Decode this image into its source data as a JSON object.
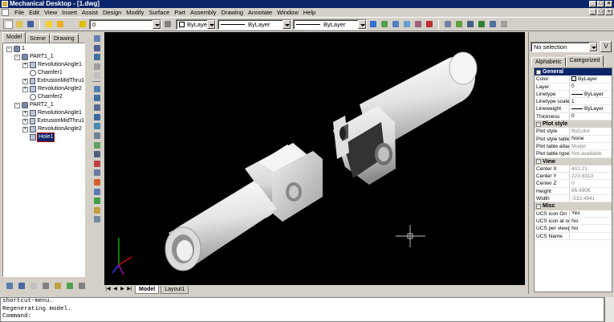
{
  "title": "Mechanical Desktop - [1.dwg]",
  "menu": [
    "File",
    "Edit",
    "View",
    "Insert",
    "Assist",
    "Design",
    "Modify",
    "Surface",
    "Part",
    "Assembly",
    "Drawing",
    "Annotate",
    "Window",
    "Help"
  ],
  "toolbar": {
    "layer_value": "0",
    "color_value": "ByLayer",
    "linetype_value": "ByLayer",
    "lineweight_value": "ByLayer"
  },
  "browser": {
    "tabs": [
      "Model",
      "Scene",
      "Drawing"
    ],
    "active_tab": "Model",
    "tree": [
      {
        "label": "1",
        "level": 0,
        "expander": "⊟",
        "kind": "part"
      },
      {
        "label": "PART1_1",
        "level": 1,
        "expander": "⊟",
        "kind": "part"
      },
      {
        "label": "RevolutionAngle1",
        "level": 2,
        "expander": "⊞",
        "kind": "feature"
      },
      {
        "label": "Chamfer1",
        "level": 2,
        "expander": "",
        "kind": "chamfer"
      },
      {
        "label": "ExtrusionMidThru1",
        "level": 2,
        "expander": "⊞",
        "kind": "feature"
      },
      {
        "label": "RevolutionAngle2",
        "level": 2,
        "expander": "⊞",
        "kind": "feature"
      },
      {
        "label": "Chamfer2",
        "level": 2,
        "expander": "",
        "kind": "chamfer"
      },
      {
        "label": "PART2_1",
        "level": 1,
        "expander": "⊟",
        "kind": "part"
      },
      {
        "label": "RevolutionAngle1",
        "level": 2,
        "expander": "⊞",
        "kind": "feature"
      },
      {
        "label": "ExtrusionMidThru1",
        "level": 2,
        "expander": "⊞",
        "kind": "feature"
      },
      {
        "label": "RevolutionAngle2",
        "level": 2,
        "expander": "⊞",
        "kind": "feature"
      },
      {
        "label": "Hole1",
        "level": 2,
        "expander": "",
        "kind": "hole",
        "selected": true
      }
    ]
  },
  "layout_tabs": [
    "Model",
    "Layout1"
  ],
  "active_layout": "Model",
  "properties": {
    "selection": "No selection",
    "pick_label": "V",
    "tabs": [
      "Alphabetic",
      "Categorized"
    ],
    "active_tab": "Categorized",
    "sections": [
      {
        "name": "General",
        "rows": [
          {
            "key": "Color",
            "value": "ByLayer",
            "type": "color"
          },
          {
            "key": "Layer",
            "value": "0"
          },
          {
            "key": "Linetype",
            "value": "ByLayer",
            "type": "line"
          },
          {
            "key": "Linetype scale",
            "value": "1"
          },
          {
            "key": "Lineweight",
            "value": "ByLayer",
            "type": "line"
          },
          {
            "key": "Thickness",
            "value": "0"
          }
        ]
      },
      {
        "name": "Plot style",
        "rows": [
          {
            "key": "Plot style",
            "value": "ByColor",
            "readonly": true
          },
          {
            "key": "Plot style table",
            "value": "None"
          },
          {
            "key": "Plot table attach",
            "value": "Model",
            "readonly": true
          },
          {
            "key": "Plot table type",
            "value": "Not available",
            "readonly": true
          }
        ]
      },
      {
        "name": "View",
        "rows": [
          {
            "key": "Center X",
            "value": "402.21",
            "readonly": true
          },
          {
            "key": "Center Y",
            "value": "223.8313",
            "readonly": true
          },
          {
            "key": "Center Z",
            "value": "0",
            "readonly": true
          },
          {
            "key": "Height",
            "value": "86.4906",
            "readonly": true
          },
          {
            "key": "Width",
            "value": "-533.4941",
            "readonly": true
          }
        ]
      },
      {
        "name": "Misc",
        "rows": [
          {
            "key": "UCS icon On",
            "value": "Yes"
          },
          {
            "key": "UCS icon at origin",
            "value": "No"
          },
          {
            "key": "UCS per viewport",
            "value": "No"
          },
          {
            "key": "UCS Name",
            "value": ""
          }
        ]
      }
    ]
  },
  "command_line": [
    "shortcut-menu.",
    "Regenerating model.",
    "Command:"
  ],
  "colors": {
    "title_bar": "#0a246a",
    "viewport": "#000000",
    "part": "#e8e8e8",
    "chrome": "#d4d0c8"
  }
}
